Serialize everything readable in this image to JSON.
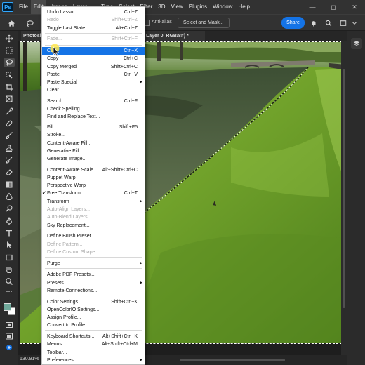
{
  "app": {
    "logo": "Ps",
    "menu": [
      "File",
      "Edit",
      "Image",
      "Layer",
      "Type",
      "Select",
      "Filter",
      "3D",
      "View",
      "Plugins",
      "Window",
      "Help"
    ],
    "active_menu": "Edit",
    "window_controls": [
      "—",
      "◻",
      "✕"
    ]
  },
  "options_bar": {
    "anti_alias_label": "Anti-alias",
    "select_mask_label": "Select and Mask...",
    "share_label": "Share"
  },
  "document": {
    "tab_title": "Photosh",
    "tab_suffix": "Layer 0, RGB/8#) *",
    "zoom": "130.91%"
  },
  "edit_menu": {
    "items": [
      {
        "label": "Undo Lasso",
        "shortcut": "Ctrl+Z"
      },
      {
        "label": "Redo",
        "shortcut": "Shift+Ctrl+Z",
        "disabled": true
      },
      {
        "label": "Toggle Last State",
        "shortcut": "Alt+Ctrl+Z"
      },
      {
        "label": "Fade...",
        "shortcut": "Shift+Ctrl+F",
        "disabled": true
      },
      {
        "label": "Cut",
        "shortcut": "Ctrl+X",
        "highlighted": true
      },
      {
        "label": "Copy",
        "shortcut": "Ctrl+C"
      },
      {
        "label": "Copy Merged",
        "shortcut": "Shift+Ctrl+C"
      },
      {
        "label": "Paste",
        "shortcut": "Ctrl+V"
      },
      {
        "label": "Paste Special",
        "submenu": true
      },
      {
        "label": "Clear"
      },
      {
        "label": "Search",
        "shortcut": "Ctrl+F"
      },
      {
        "label": "Check Spelling..."
      },
      {
        "label": "Find and Replace Text..."
      },
      {
        "label": "Fill...",
        "shortcut": "Shift+F5"
      },
      {
        "label": "Stroke..."
      },
      {
        "label": "Content-Aware Fill..."
      },
      {
        "label": "Generative Fill..."
      },
      {
        "label": "Generate Image..."
      },
      {
        "label": "Content-Aware Scale",
        "shortcut": "Alt+Shift+Ctrl+C"
      },
      {
        "label": "Puppet Warp"
      },
      {
        "label": "Perspective Warp"
      },
      {
        "label": "Free Transform",
        "shortcut": "Ctrl+T",
        "checked": true
      },
      {
        "label": "Transform",
        "submenu": true
      },
      {
        "label": "Auto-Align Layers...",
        "disabled": true
      },
      {
        "label": "Auto-Blend Layers...",
        "disabled": true
      },
      {
        "label": "Sky Replacement..."
      },
      {
        "label": "Define Brush Preset..."
      },
      {
        "label": "Define Pattern...",
        "disabled": true
      },
      {
        "label": "Define Custom Shape...",
        "disabled": true
      },
      {
        "label": "Purge",
        "submenu": true
      },
      {
        "label": "Adobe PDF Presets..."
      },
      {
        "label": "Presets",
        "submenu": true
      },
      {
        "label": "Remote Connections..."
      },
      {
        "label": "Color Settings...",
        "shortcut": "Shift+Ctrl+K"
      },
      {
        "label": "OpenColorIO Settings..."
      },
      {
        "label": "Assign Profile..."
      },
      {
        "label": "Convert to Profile..."
      },
      {
        "label": "Keyboard Shortcuts...",
        "shortcut": "Alt+Shift+Ctrl+K"
      },
      {
        "label": "Menus...",
        "shortcut": "Alt+Shift+Ctrl+M"
      },
      {
        "label": "Toolbar..."
      },
      {
        "label": "Preferences",
        "submenu": true
      }
    ]
  },
  "colors": {
    "accent": "#1473e6",
    "menubar": "#323232",
    "toolbar": "#2b2b2b",
    "canvas_bg": "#1e1e1e"
  }
}
